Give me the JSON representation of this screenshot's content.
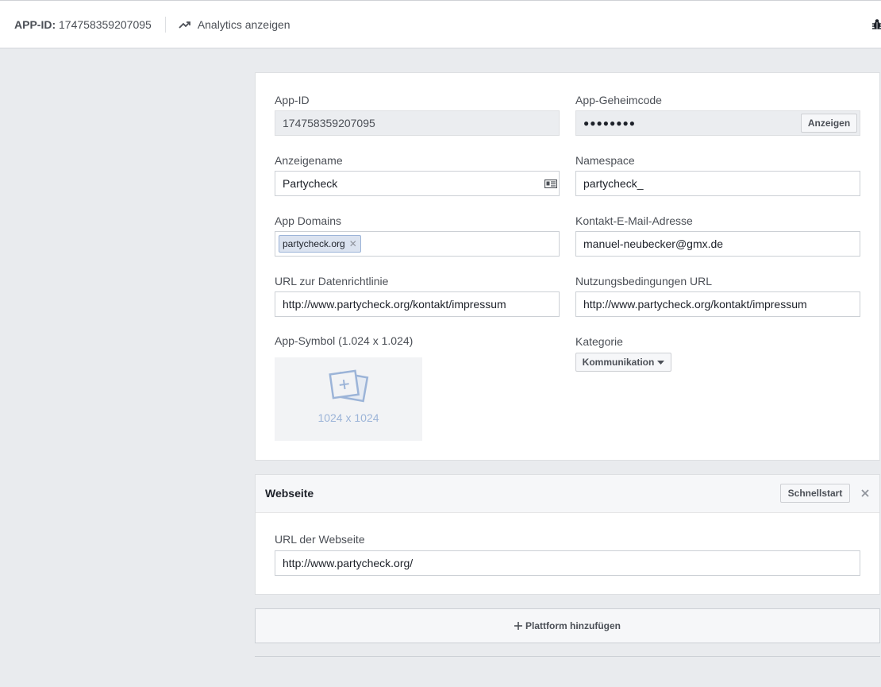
{
  "topbar": {
    "app_id_label": "APP-ID:",
    "app_id_value": "174758359207095",
    "analytics_label": "Analytics anzeigen"
  },
  "basic": {
    "app_id": {
      "label": "App-ID",
      "value": "174758359207095"
    },
    "app_secret": {
      "label": "App-Geheimcode",
      "value": "●●●●●●●●",
      "show_button": "Anzeigen"
    },
    "display_name": {
      "label": "Anzeigename",
      "value": "Partycheck"
    },
    "namespace": {
      "label": "Namespace",
      "value": "partycheck_"
    },
    "app_domains": {
      "label": "App Domains",
      "tags": [
        "partycheck.org"
      ]
    },
    "contact_email": {
      "label": "Kontakt-E-Mail-Adresse",
      "value": "manuel-neubecker@gmx.de"
    },
    "privacy_url": {
      "label": "URL zur Datenrichtlinie",
      "value": "http://www.partycheck.org/kontakt/impressum"
    },
    "terms_url": {
      "label": "Nutzungsbedingungen URL",
      "value": "http://www.partycheck.org/kontakt/impressum"
    },
    "app_icon": {
      "label": "App-Symbol (1.024 x 1.024)",
      "placeholder": "1024 x 1024"
    },
    "category": {
      "label": "Kategorie",
      "value": "Kommunikation"
    }
  },
  "website": {
    "title": "Webseite",
    "quickstart_button": "Schnellstart",
    "url_label": "URL der Webseite",
    "url_value": "http://www.partycheck.org/"
  },
  "add_platform": {
    "label": "Plattform hinzufügen"
  }
}
